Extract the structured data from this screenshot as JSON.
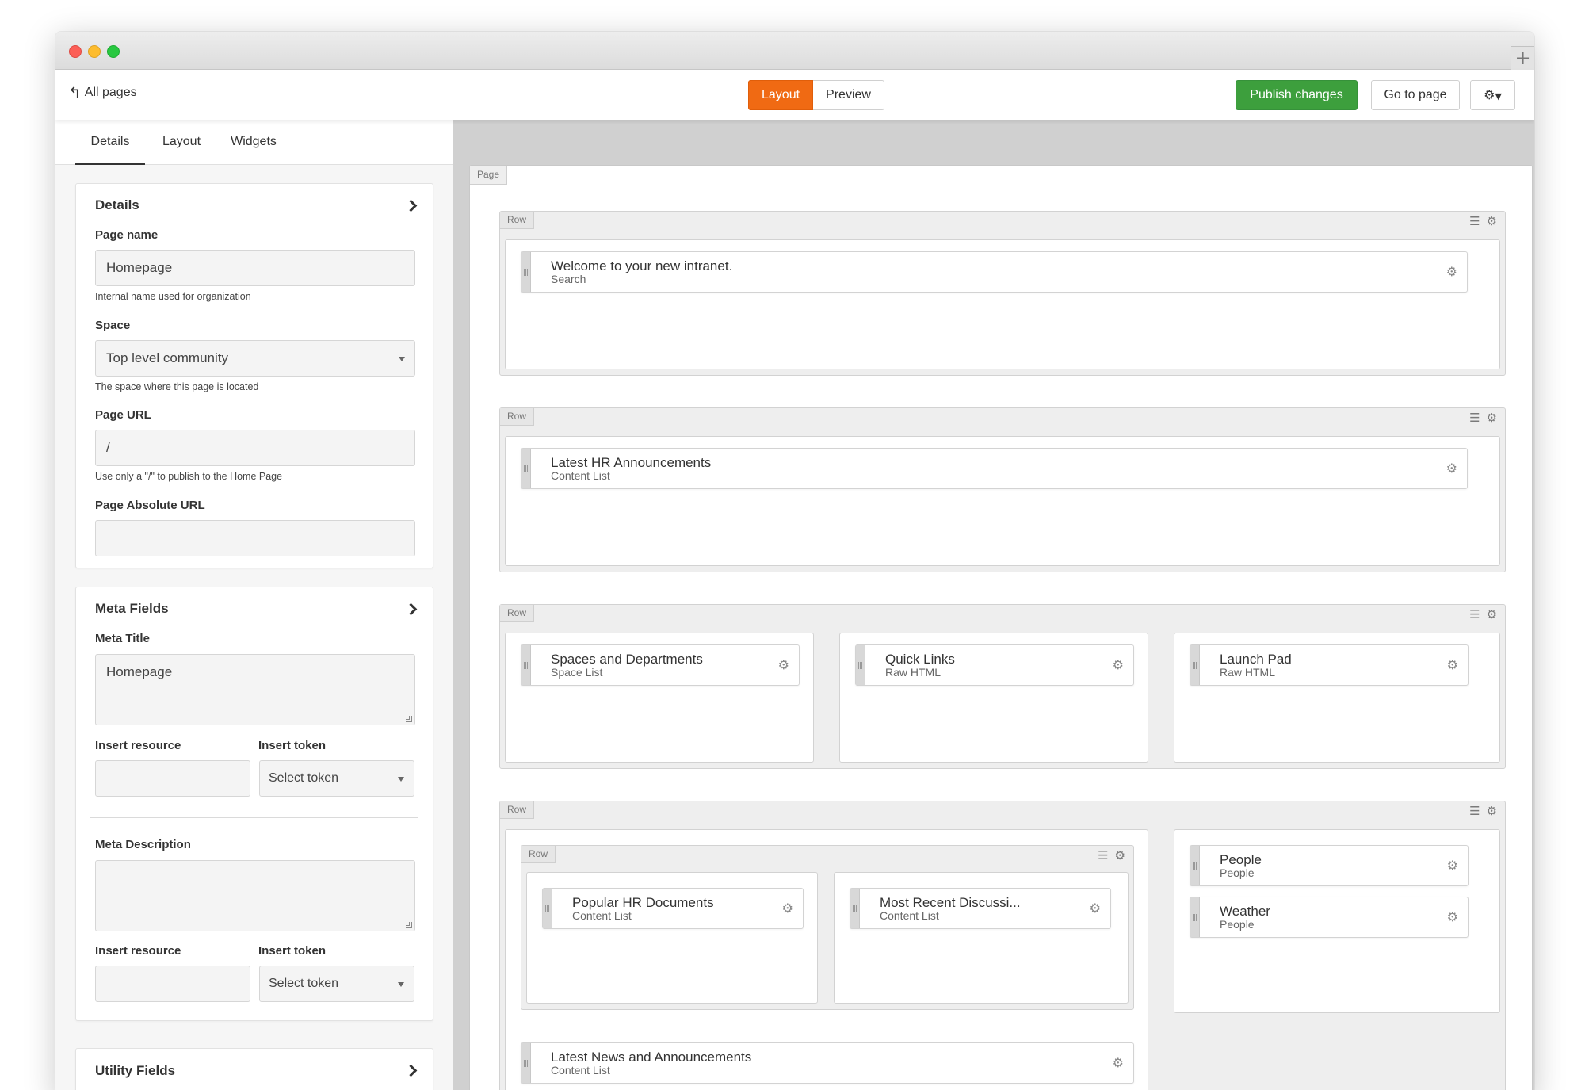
{
  "window": {
    "new_tab_icon": "plus-icon",
    "new_tab_glyph": "+"
  },
  "topbar": {
    "back_label": "All pages",
    "back_icon": "reply-arrow-icon",
    "mode_layout": "Layout",
    "mode_preview": "Preview",
    "publish_label": "Publish changes",
    "goto_label": "Go to page",
    "settings_icon": "gear-dropdown-icon",
    "colors": {
      "layout_active": "#f06a13",
      "publish": "#3d9f3d"
    }
  },
  "sidebar": {
    "tabs": [
      "Details",
      "Layout",
      "Widgets"
    ],
    "active_tab": "Details",
    "details": {
      "title": "Details",
      "page_name_label": "Page name",
      "page_name_value": "Homepage",
      "page_name_help": "Internal name used for organization",
      "space_label": "Space",
      "space_value": "Top level community",
      "space_help": "The space where this page is located",
      "page_url_label": "Page URL",
      "page_url_value": "/",
      "page_url_help": "Use only a \"/\" to publish to the Home Page",
      "abs_url_label": "Page Absolute URL",
      "abs_url_value": ""
    },
    "meta": {
      "title": "Meta Fields",
      "meta_title_label": "Meta Title",
      "meta_title_value": "Homepage",
      "insert_resource_label": "Insert resource",
      "insert_token_label": "Insert token",
      "select_token": "Select token",
      "meta_desc_label": "Meta Description",
      "meta_desc_value": "",
      "insert_resource_label_2": "Insert resource",
      "insert_token_label_2": "Insert token",
      "select_token_2": "Select token"
    },
    "utility": {
      "title": "Utility Fields"
    }
  },
  "canvas": {
    "page_tag": "Page",
    "row_tag": "Row",
    "widgets": {
      "w1": {
        "title": "Welcome to your new intranet.",
        "type": "Search"
      },
      "w2": {
        "title": "Latest HR Announcements",
        "type": "Content List"
      },
      "w3": {
        "title": "Spaces and Departments",
        "type": "Space List"
      },
      "w4": {
        "title": "Quick Links",
        "type": "Raw HTML"
      },
      "w5": {
        "title": "Launch Pad",
        "type": "Raw HTML"
      },
      "w6": {
        "title": "Popular HR Documents",
        "type": "Content List"
      },
      "w7": {
        "title": "Most Recent Discussi...",
        "type": "Content List"
      },
      "w8": {
        "title": "People",
        "type": "People"
      },
      "w9": {
        "title": "Weather",
        "type": "People"
      },
      "w10": {
        "title": "Latest News and Announcements",
        "type": "Content List"
      }
    }
  }
}
